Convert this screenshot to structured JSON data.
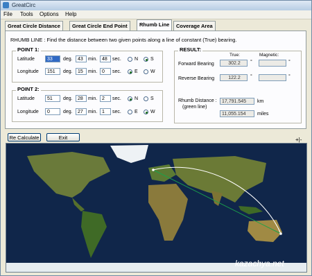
{
  "window": {
    "title": "GreatCirc"
  },
  "menu": [
    "File",
    "Tools",
    "Options",
    "Help"
  ],
  "tabs": [
    "Great Circle Distance",
    "Great Circle End Point",
    "Rhumb Line",
    "Coverage Area"
  ],
  "heading": "RHUMB LINE :  Find the distance between two given points along a line of constant (True) bearing.",
  "point1": {
    "title": "POINT 1:",
    "latitude_label": "Latitude",
    "lat_deg": "33",
    "lat_min": "43",
    "lat_sec": "48",
    "longitude_label": "Longitude",
    "lon_deg": "151",
    "lon_min": "15",
    "lon_sec": "0",
    "ns": "S",
    "ew": "E"
  },
  "point2": {
    "title": "POINT 2:",
    "latitude_label": "Latitude",
    "lat_deg": "51",
    "lat_min": "28",
    "lat_sec": "2",
    "longitude_label": "Longitude",
    "lon_deg": "0",
    "lon_min": "27",
    "lon_sec": "1",
    "ns": "N",
    "ew": "W"
  },
  "units": {
    "deg": "deg.",
    "min": "min.",
    "sec": "sec.",
    "n": "N",
    "s": "S",
    "e": "E",
    "w": "W"
  },
  "result": {
    "title": "RESULT:",
    "true_header": "True:",
    "magnetic_header": "Magnetic:",
    "forward_label": "Forward Bearing",
    "forward_true": "302.2",
    "reverse_label": "Reverse Bearing",
    "reverse_true": "122.2",
    "degree_symbol": "°",
    "rhumb_label": "Rhumb Distance :",
    "rhumb_sublabel": "(green line)",
    "distance_km": "17,791.545",
    "km_unit": "km",
    "distance_miles": "11,055.154",
    "miles_unit": "miles"
  },
  "buttons": {
    "recalculate": "Re Calculate",
    "exit": "Exit"
  },
  "zoom": "+|-",
  "watermark": "kazachya.net",
  "colors": {
    "rhumb_line": "#1aa34a",
    "great_circle": "#ffffff",
    "ocean": "#10264a",
    "land": "#4f6b2c"
  }
}
